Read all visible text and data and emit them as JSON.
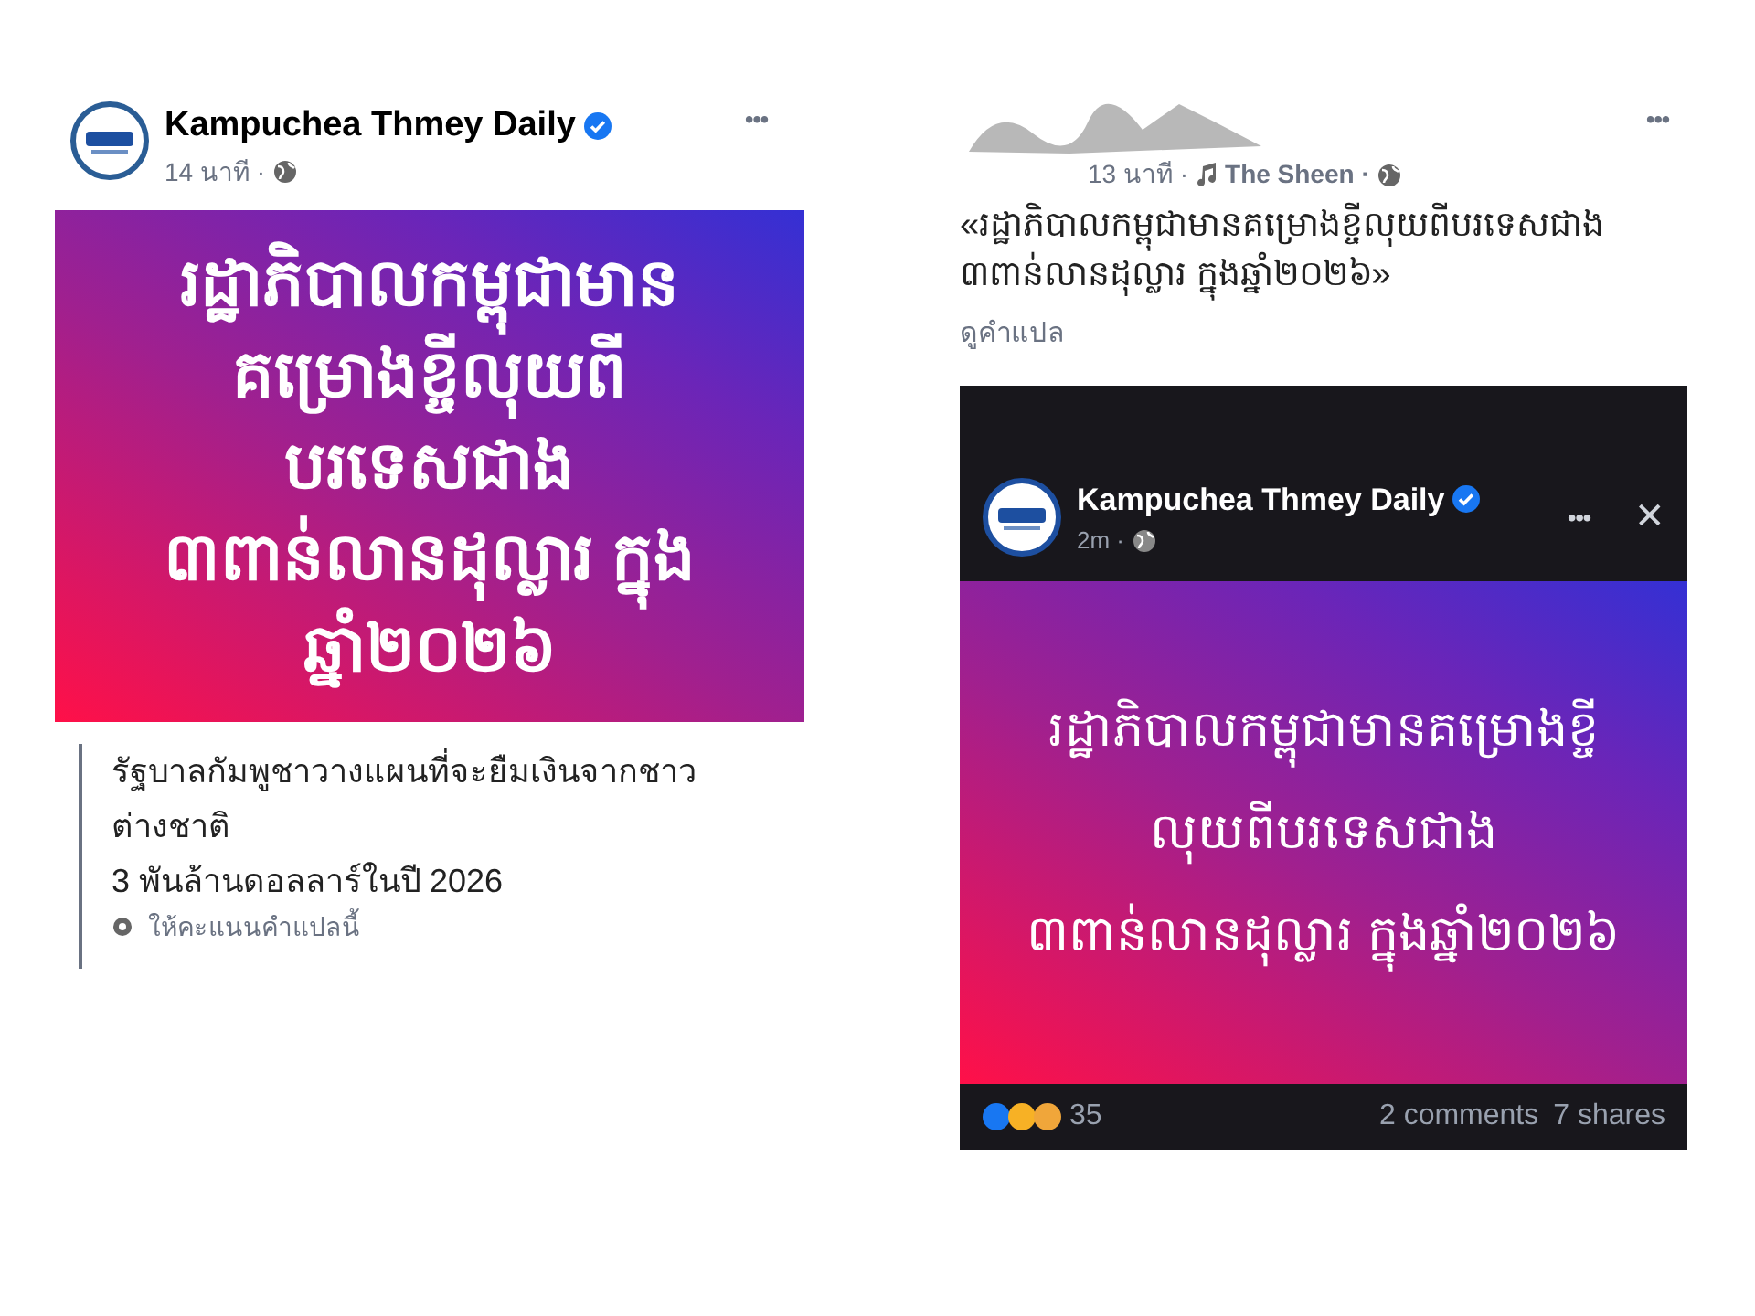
{
  "left_post": {
    "page_name": "Kampuchea Thmey Daily",
    "verified": true,
    "time": "14 นาที ·",
    "more": "•••",
    "image_lines": [
      "រដ្ឋាភិបាលកម្ពុជាមាន",
      "គម្រោងខ្ចីលុយពី",
      "បរទេសជាង",
      "៣ពាន់លានដុល្លារ ក្នុង",
      "ឆ្នាំ២០២៦"
    ],
    "translation_lines": [
      "รัฐบาลกัมพูชาวางแผนที่จะยืมเงินจากชาว",
      "ต่างชาติ",
      "3 พันล้านดอลลาร์ในปี 2026"
    ],
    "rate_translation": "ให้คะแนนคำแปลนี้"
  },
  "right_post": {
    "time": "13 นาที ·",
    "music": "The Sheen ·",
    "more": "•••",
    "caption": "«រដ្ឋាភិបាលកម្ពុជាមានគម្រោងខ្ចីលុយពីបរទេសជាង ៣ពាន់លានដុល្លារ ក្នុងឆ្នាំ២០២៦»",
    "see_translation": "ดูคำแปล",
    "embedded": {
      "page_name": "Kampuchea Thmey Daily",
      "verified": true,
      "time": "2m ·",
      "more": "•••",
      "close": "✕",
      "image_lines": [
        "រដ្ឋាភិបាលកម្ពុជាមានគម្រោងខ្ចី",
        "លុយពីបរទេសជាង",
        "៣ពាន់លានដុល្លារ ក្នុងឆ្នាំ២០២៦"
      ],
      "reaction_count": "35",
      "comments": "2 comments",
      "shares": "7 shares"
    }
  }
}
